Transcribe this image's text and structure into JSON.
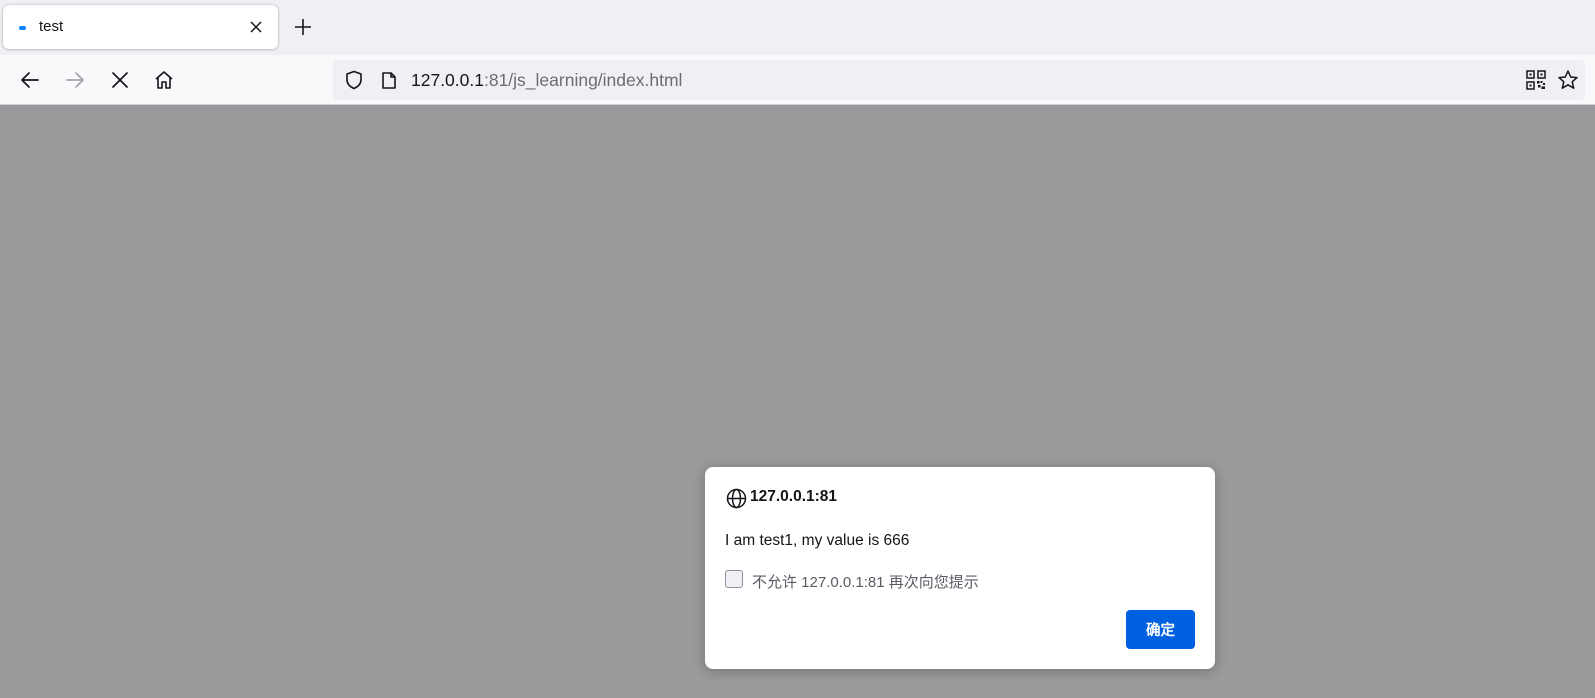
{
  "tab": {
    "title": "test",
    "favicon_color": "#0b84ff"
  },
  "toolbar": {
    "back_icon": "back-arrow-icon",
    "forward_icon": "forward-arrow-icon",
    "stop_icon": "stop-icon",
    "home_icon": "home-icon"
  },
  "urlbar": {
    "host": "127.0.0.1",
    "rest": ":81/js_learning/index.html",
    "icons": [
      "shield-icon",
      "page-icon",
      "qr-code-icon",
      "star-icon"
    ]
  },
  "dialog": {
    "origin": "127.0.0.1:81",
    "message": "I am test1, my value is 666",
    "checkbox_label": "不允许 127.0.0.1:81 再次向您提示",
    "ok_label": "确定",
    "accent_color": "#0061e0"
  }
}
